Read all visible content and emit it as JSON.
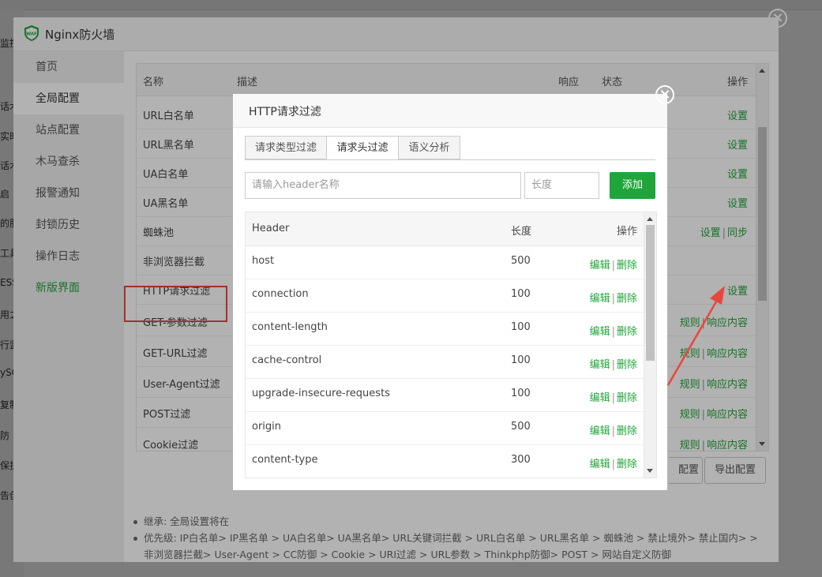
{
  "background": {
    "left_fragments": [
      "监控",
      "话术",
      "实时",
      "话术",
      "启",
      "的服",
      "工具",
      "ESS",
      "用之",
      "行监",
      "ySQ",
      "复制",
      "防",
      "保护",
      "告创"
    ]
  },
  "window": {
    "title": "Nginx防火墙",
    "logo_text": "WAF"
  },
  "menu": {
    "items": [
      "首页",
      "全局配置",
      "站点配置",
      "木马查杀",
      "报警通知",
      "封锁历史",
      "操作日志",
      "新版界面"
    ]
  },
  "rules_table": {
    "headers": {
      "name": "名称",
      "desc": "描述",
      "response": "响应",
      "status": "状态",
      "action": "操作"
    },
    "rows": [
      {
        "name": "URL白名单",
        "actions": [
          "设置"
        ]
      },
      {
        "name": "URL黑名单",
        "actions": [
          "设置"
        ]
      },
      {
        "name": "UA白名单",
        "actions": [
          "设置"
        ]
      },
      {
        "name": "UA黑名单",
        "actions": [
          "设置"
        ]
      },
      {
        "name": "蜘蛛池",
        "actions": [
          "设置",
          "同步"
        ]
      },
      {
        "name": "非浏览器拦截",
        "actions": []
      },
      {
        "name": "HTTP请求过滤",
        "actions": [
          "设置"
        ]
      },
      {
        "name": "GET-参数过滤",
        "actions": [
          "规则",
          "响应内容"
        ]
      },
      {
        "name": "GET-URL过滤",
        "actions": [
          "规则",
          "响应内容"
        ]
      },
      {
        "name": "User-Agent过滤",
        "actions": [
          "规则",
          "响应内容"
        ]
      },
      {
        "name": "POST过滤",
        "actions": [
          "规则",
          "响应内容"
        ]
      },
      {
        "name": "Cookie过滤",
        "actions": [
          "规则",
          "响应内容"
        ]
      }
    ]
  },
  "bottom_buttons": {
    "import_partial": "配置",
    "export": "导出配置"
  },
  "notes": [
    "继承: 全局设置将在",
    "优先级: IP白名单> IP黑名单 > UA白名单> UA黑名单> URL关键词拦截 > URL白名单 > URL黑名单 > 蜘蛛池 > 禁止境外> 禁止国内> > 非浏览器拦截> User-Agent > CC防御 > Cookie > URI过滤 > URL参数 > Thinkphp防御> POST > 网站自定义防御"
  ],
  "dialog": {
    "title": "HTTP请求过滤",
    "tabs": [
      "请求类型过滤",
      "请求头过滤",
      "语义分析"
    ],
    "active_tab": "请求头过滤",
    "header_input_placeholder": "请输入header名称",
    "length_input_placeholder": "长度",
    "add_button": "添加",
    "table_headers": {
      "header": "Header",
      "length": "长度",
      "action": "操作"
    },
    "edit_label": "编辑",
    "delete_label": "删除",
    "rows": [
      {
        "header": "host",
        "length": "500"
      },
      {
        "header": "connection",
        "length": "100"
      },
      {
        "header": "content-length",
        "length": "100"
      },
      {
        "header": "cache-control",
        "length": "100"
      },
      {
        "header": "upgrade-insecure-requests",
        "length": "100"
      },
      {
        "header": "origin",
        "length": "500"
      },
      {
        "header": "content-type",
        "length": "300"
      }
    ]
  },
  "colors": {
    "accent_green": "#20a53a",
    "highlight_red": "#e8473e"
  }
}
